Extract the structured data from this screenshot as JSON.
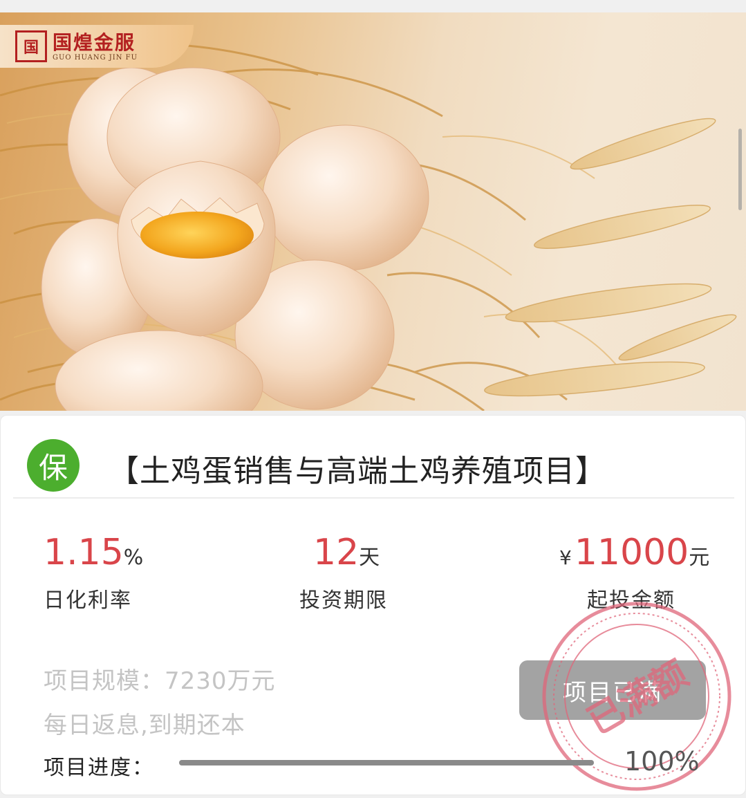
{
  "brand": {
    "seal": "国",
    "name": "国煌金服",
    "pinyin": "GUO HUANG JIN FU"
  },
  "hero": {
    "image": "eggs-on-straw-photo"
  },
  "product": {
    "badge": "保",
    "title": "【土鸡蛋销售与高端土鸡养殖项目】"
  },
  "stats": {
    "rate": {
      "value": "1.15",
      "unit": "%",
      "label": "日化利率"
    },
    "term": {
      "value": "12",
      "unit": "天",
      "label": "投资期限"
    },
    "amount": {
      "currency": "¥",
      "value": "11000",
      "unit": "元",
      "label": "起投金额"
    }
  },
  "meta": {
    "scale": "项目规模：7230万元",
    "repayment": "每日返息,到期还本"
  },
  "status": {
    "button_label": "项目已满",
    "stamp_text": "已满额"
  },
  "progress": {
    "label": "项目进度：",
    "percent_text": "100%",
    "fraction": 1.0
  },
  "colors": {
    "accent_red": "#d9454a",
    "badge_green": "#4cae2e",
    "disabled_gray": "#a3a3a3",
    "stamp_red": "#e0667a"
  }
}
